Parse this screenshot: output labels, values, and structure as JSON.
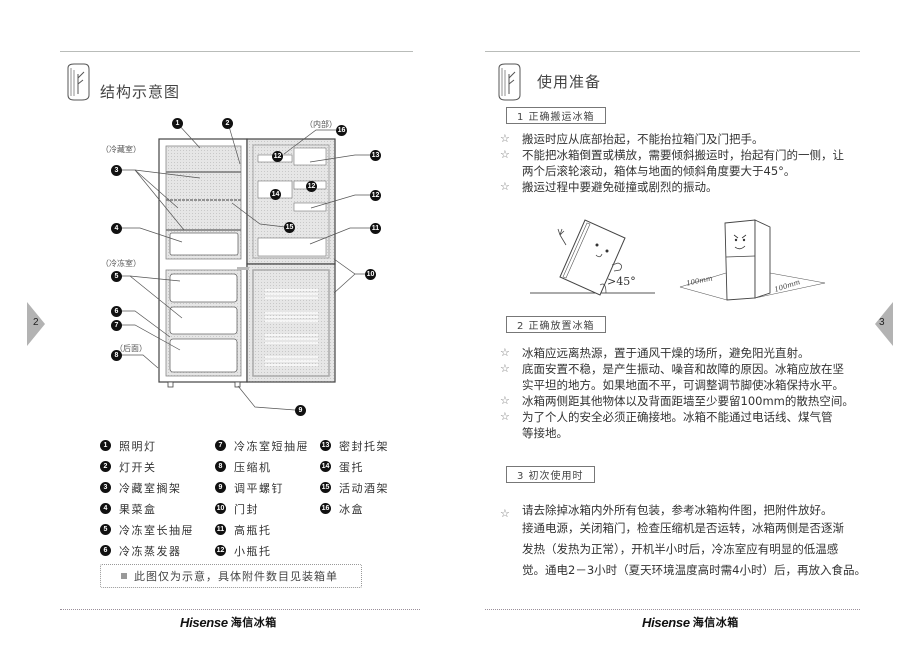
{
  "left_page": {
    "page_number": "2",
    "heading": "结构示意图",
    "diagram": {
      "region_labels": {
        "fridge": "（冷藏室）",
        "freezer": "（冷冻室）",
        "back": "（后面）",
        "inside": "（内部）"
      },
      "callouts": [
        "1",
        "2",
        "3",
        "4",
        "5",
        "6",
        "7",
        "8",
        "9",
        "10",
        "11",
        "12",
        "13",
        "14",
        "15",
        "16"
      ]
    },
    "legend": [
      {
        "num": "1",
        "label": "照明灯"
      },
      {
        "num": "2",
        "label": "灯开关"
      },
      {
        "num": "3",
        "label": "冷藏室搁架"
      },
      {
        "num": "4",
        "label": "果菜盒"
      },
      {
        "num": "5",
        "label": "冷冻室长抽屉"
      },
      {
        "num": "6",
        "label": "冷冻蒸发器"
      },
      {
        "num": "7",
        "label": "冷冻室短抽屉"
      },
      {
        "num": "8",
        "label": "压缩机"
      },
      {
        "num": "9",
        "label": "调平螺钉"
      },
      {
        "num": "10",
        "label": "门封"
      },
      {
        "num": "11",
        "label": "高瓶托"
      },
      {
        "num": "12",
        "label": "小瓶托"
      },
      {
        "num": "13",
        "label": "密封托架"
      },
      {
        "num": "14",
        "label": "蛋托"
      },
      {
        "num": "15",
        "label": "活动酒架"
      },
      {
        "num": "16",
        "label": "冰盒"
      }
    ],
    "note": "此图仅为示意，具体附件数目见装箱单",
    "footer": {
      "brand_en": "Hisense",
      "brand_cn": "海信冰箱"
    }
  },
  "right_page": {
    "page_number": "3",
    "heading": "使用准备",
    "sections": [
      {
        "title": "1 正确搬运冰箱",
        "bullets": [
          [
            "搬运时应从底部抬起，不能抬拉箱门及门把手。"
          ],
          [
            "不能把冰箱倒置或横放，需要倾斜搬运时，抬起有门的一侧，让",
            "两个后滚轮滚动，箱体与地面的倾斜角度要大于45°。"
          ],
          [
            "搬运过程中要避免碰撞或剧烈的振动。"
          ]
        ],
        "illustration": {
          "angle_label": ">45°",
          "clearance_left": "100mm",
          "clearance_right": "100mm"
        }
      },
      {
        "title": "2 正确放置冰箱",
        "bullets": [
          [
            "冰箱应远离热源，置于通风干燥的场所，避免阳光直射。"
          ],
          [
            "底面安置不稳，是产生振动、噪音和故障的原因。冰箱应放在坚",
            "实平坦的地方。如果地面不平，可调整调节脚使冰箱保持水平。"
          ],
          [
            "冰箱两侧距其他物体以及背面距墙至少要留100mm的散热空间。"
          ],
          [
            "为了个人的安全必须正确接地。冰箱不能通过电话线、煤气管",
            "等接地。"
          ]
        ]
      },
      {
        "title": "3 初次使用时",
        "bullets": [
          [
            "请去除掉冰箱内外所有包装，参考冰箱构件图，把附件放好。"
          ]
        ],
        "continuation": [
          "接通电源，关闭箱门，检查压缩机是否运转，冰箱两侧是否逐渐",
          "发热（发热为正常），开机半小时后，冷冻室应有明显的低温感",
          "觉。通电2－3小时（夏天环境温度高时需4小时）后，再放入食品。"
        ]
      }
    ],
    "footer": {
      "brand_en": "Hisense",
      "brand_cn": "海信冰箱"
    }
  }
}
